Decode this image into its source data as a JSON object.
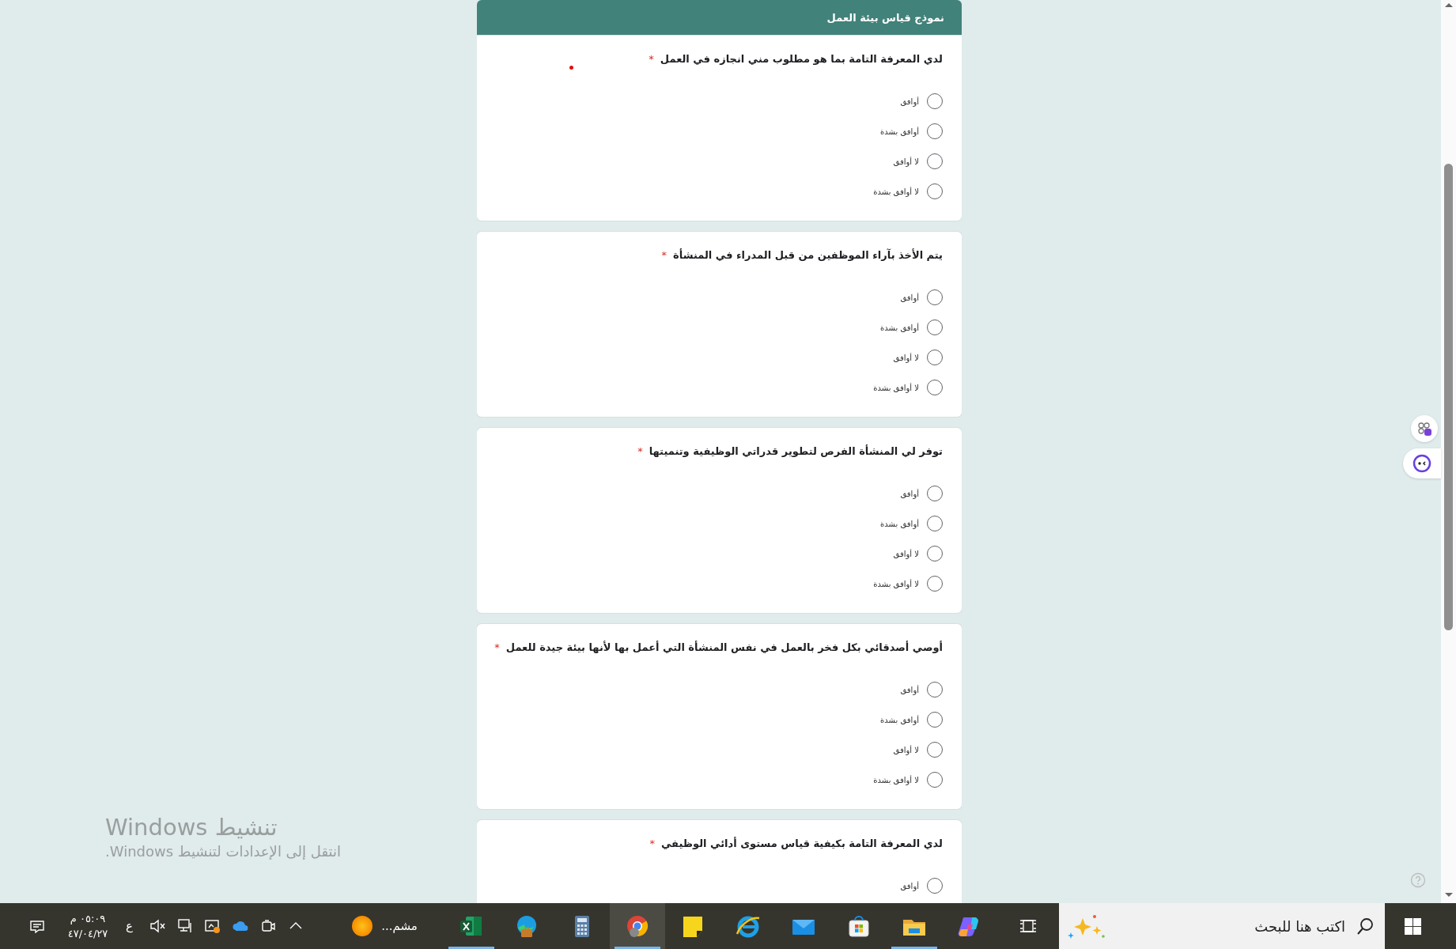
{
  "form": {
    "title": "نموذج قياس بيئة العمل",
    "questions": [
      {
        "text": "لدي المعرفة التامة بما هو مطلوب مني انجازه في العمل",
        "required_mark": "*",
        "options": [
          {
            "label": "أوافق",
            "selected": false
          },
          {
            "label": "أوافق بشدة",
            "selected": false
          },
          {
            "label": "لا أوافق",
            "selected": false
          },
          {
            "label": "لا أوافق بشدة",
            "selected": false
          }
        ]
      },
      {
        "text": "يتم الأخذ بآراء الموظفين من قبل المدراء في المنشأة",
        "required_mark": "*",
        "options": [
          {
            "label": "أوافق",
            "selected": false
          },
          {
            "label": "أوافق بشدة",
            "selected": false
          },
          {
            "label": "لا أوافق",
            "selected": false
          },
          {
            "label": "لا أوافق بشدة",
            "selected": false
          }
        ]
      },
      {
        "text": "توفر لي المنشأة الفرص لتطوير قدراتي الوظيفية وتنميتها",
        "required_mark": "*",
        "options": [
          {
            "label": "أوافق",
            "selected": false
          },
          {
            "label": "أوافق بشدة",
            "selected": false
          },
          {
            "label": "لا أوافق",
            "selected": false
          },
          {
            "label": "لا أوافق بشدة",
            "selected": false
          }
        ]
      },
      {
        "text": "أوصي أصدقائي بكل فخر بالعمل في نفس المنشأة التي أعمل بها لأنها بيئة جيدة للعمل",
        "required_mark": "*",
        "options": [
          {
            "label": "أوافق",
            "selected": false
          },
          {
            "label": "أوافق بشدة",
            "selected": false
          },
          {
            "label": "لا أوافق",
            "selected": false
          },
          {
            "label": "لا أوافق بشدة",
            "selected": false
          }
        ]
      },
      {
        "text": "لدي المعرفة التامة بكيفية قياس مستوى أدائي الوظيفي",
        "required_mark": "*",
        "options": [
          {
            "label": "أوافق",
            "selected": false
          }
        ]
      }
    ]
  },
  "activation_notice": {
    "title": "تنشيط Windows",
    "message": "انتقل إلى الإعدادات لتنشيط Windows."
  },
  "taskbar": {
    "time": "٠٥:٠٩ م",
    "date": "٤٧/٠٤/٢٧",
    "language": "ع",
    "weather": "مشم...",
    "apps": [
      {
        "kind": "excel",
        "running": true,
        "selected": false
      },
      {
        "kind": "edge",
        "running": false,
        "selected": false
      },
      {
        "kind": "calculator",
        "running": false,
        "selected": false
      },
      {
        "kind": "chrome",
        "running": true,
        "selected": true
      },
      {
        "kind": "notes",
        "running": false,
        "selected": false
      },
      {
        "kind": "ie",
        "running": false,
        "selected": false
      },
      {
        "kind": "mail",
        "running": false,
        "selected": false
      },
      {
        "kind": "store",
        "running": false,
        "selected": false
      },
      {
        "kind": "explorer",
        "running": true,
        "selected": false
      },
      {
        "kind": "copilot",
        "running": false,
        "selected": false
      }
    ],
    "search": {
      "placeholder": "اكتب هنا للبحث"
    }
  }
}
